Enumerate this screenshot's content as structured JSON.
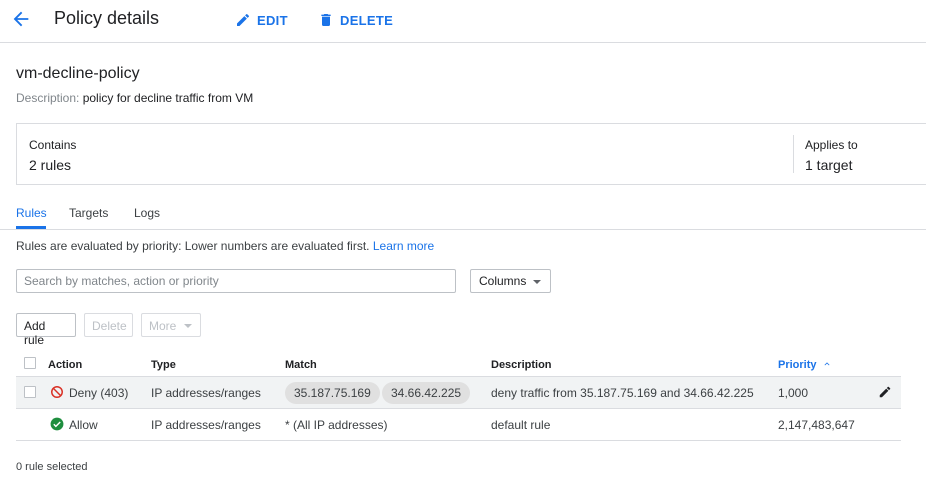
{
  "header": {
    "title": "Policy details",
    "edit_label": "EDIT",
    "delete_label": "DELETE"
  },
  "policy": {
    "name": "vm-decline-policy",
    "description_key": "Description:",
    "description": "policy for decline traffic from VM"
  },
  "summary": {
    "contains_label": "Contains",
    "contains_value": "2 rules",
    "applies_label": "Applies to",
    "applies_value": "1 target"
  },
  "tabs": [
    {
      "label": "Rules",
      "active": true
    },
    {
      "label": "Targets",
      "active": false
    },
    {
      "label": "Logs",
      "active": false
    }
  ],
  "info": {
    "text": "Rules are evaluated by priority: Lower numbers are evaluated first.",
    "link": "Learn more"
  },
  "search": {
    "placeholder": "Search by matches, action or priority"
  },
  "columns_label": "Columns",
  "toolbar": {
    "add_rule": "Add rule",
    "delete": "Delete",
    "more": "More"
  },
  "table": {
    "headers": {
      "action": "Action",
      "type": "Type",
      "match": "Match",
      "description": "Description",
      "priority": "Priority"
    },
    "rows": [
      {
        "action": "Deny (403)",
        "action_icon": "deny-icon",
        "type": "IP addresses/ranges",
        "match": [
          "35.187.75.169",
          "34.66.42.225"
        ],
        "description": "deny traffic from 35.187.75.169 and 34.66.42.225",
        "priority": "1,000"
      },
      {
        "action": "Allow",
        "action_icon": "allow-check-icon",
        "type": "IP addresses/ranges",
        "match": "* (All IP addresses)",
        "description": "default rule",
        "priority": "2,147,483,647"
      }
    ]
  },
  "footer": {
    "selection": "0 rule selected"
  },
  "colors": {
    "accent": "#1a73e8",
    "deny": "#d93025",
    "allow": "#1e8e3e"
  }
}
